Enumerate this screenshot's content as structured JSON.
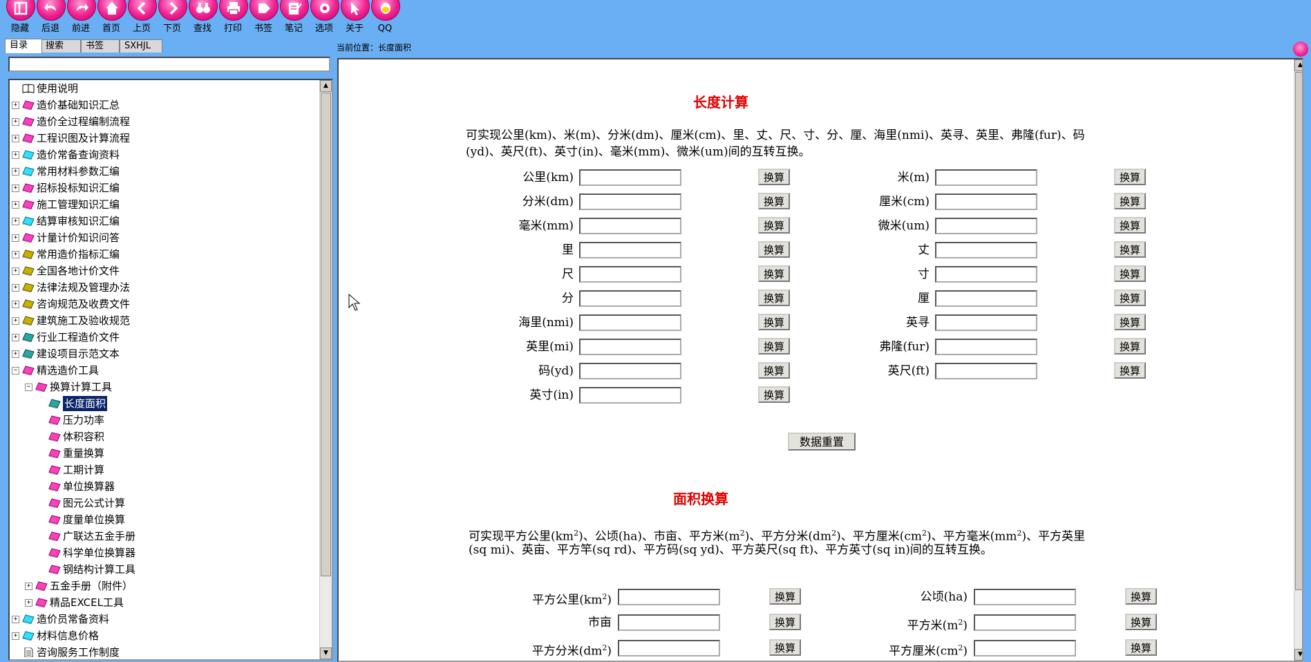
{
  "toolbar": {
    "buttons": [
      {
        "label": "隐藏",
        "icon": "hide-icon"
      },
      {
        "label": "后退",
        "icon": "back-icon"
      },
      {
        "label": "前进",
        "icon": "forward-icon"
      },
      {
        "label": "首页",
        "icon": "home-icon"
      },
      {
        "label": "上页",
        "icon": "prev-page-icon"
      },
      {
        "label": "下页",
        "icon": "next-page-icon"
      },
      {
        "label": "查找",
        "icon": "binoculars-icon"
      },
      {
        "label": "打印",
        "icon": "printer-icon"
      },
      {
        "label": "书签",
        "icon": "bookmark-icon"
      },
      {
        "label": "笔记",
        "icon": "note-icon"
      },
      {
        "label": "选项",
        "icon": "gear-icon"
      },
      {
        "label": "关于",
        "icon": "pointer-icon"
      },
      {
        "label": "QQ",
        "icon": "qq-icon"
      }
    ]
  },
  "tabs": [
    "目录",
    "搜索",
    "书签",
    "SXHJL"
  ],
  "search": {
    "value": ""
  },
  "tree": [
    {
      "label": "使用说明",
      "icon": "doc-book-icon",
      "level": 0,
      "toggle": ""
    },
    {
      "label": "造价基础知识汇总",
      "icon": "magenta-book-icon",
      "level": 0,
      "toggle": "+"
    },
    {
      "label": "造价全过程编制流程",
      "icon": "magenta-book-icon",
      "level": 0,
      "toggle": "+"
    },
    {
      "label": "工程识图及计算流程",
      "icon": "magenta-book-icon",
      "level": 0,
      "toggle": "+"
    },
    {
      "label": "造价常备查询资料",
      "icon": "cyan-book-icon",
      "level": 0,
      "toggle": "+"
    },
    {
      "label": "常用材料参数汇编",
      "icon": "cyan-book-icon",
      "level": 0,
      "toggle": "+"
    },
    {
      "label": "招标投标知识汇编",
      "icon": "magenta-book-icon",
      "level": 0,
      "toggle": "+"
    },
    {
      "label": "施工管理知识汇编",
      "icon": "magenta-book-icon",
      "level": 0,
      "toggle": "+"
    },
    {
      "label": "结算审核知识汇编",
      "icon": "cyan-book-icon",
      "level": 0,
      "toggle": "+"
    },
    {
      "label": "计量计价知识问答",
      "icon": "magenta-book-icon",
      "level": 0,
      "toggle": "+"
    },
    {
      "label": "常用造价指标汇编",
      "icon": "olive-book-icon",
      "level": 0,
      "toggle": "+"
    },
    {
      "label": "全国各地计价文件",
      "icon": "olive-book-icon",
      "level": 0,
      "toggle": "+"
    },
    {
      "label": "法律法规及管理办法",
      "icon": "olive-book-icon",
      "level": 0,
      "toggle": "+"
    },
    {
      "label": "咨询规范及收费文件",
      "icon": "olive-book-icon",
      "level": 0,
      "toggle": "+"
    },
    {
      "label": "建筑施工及验收规范",
      "icon": "olive-book-icon",
      "level": 0,
      "toggle": "+"
    },
    {
      "label": "行业工程造价文件",
      "icon": "teal-book-icon",
      "level": 0,
      "toggle": "+"
    },
    {
      "label": "建设项目示范文本",
      "icon": "teal-book-icon",
      "level": 0,
      "toggle": "+"
    },
    {
      "label": "精选造价工具",
      "icon": "magenta-book-icon",
      "level": 0,
      "toggle": "−"
    },
    {
      "label": "换算计算工具",
      "icon": "magenta-book-icon",
      "level": 1,
      "toggle": "−"
    },
    {
      "label": "长度面积",
      "icon": "teal-book-icon",
      "level": 2,
      "toggle": "",
      "selected": true
    },
    {
      "label": "压力功率",
      "icon": "magenta-book-icon",
      "level": 2,
      "toggle": ""
    },
    {
      "label": "体积容积",
      "icon": "magenta-book-icon",
      "level": 2,
      "toggle": ""
    },
    {
      "label": "重量换算",
      "icon": "magenta-book-icon",
      "level": 2,
      "toggle": ""
    },
    {
      "label": "工期计算",
      "icon": "magenta-book-icon",
      "level": 2,
      "toggle": ""
    },
    {
      "label": "单位换算器",
      "icon": "magenta-book-icon",
      "level": 2,
      "toggle": ""
    },
    {
      "label": "图元公式计算",
      "icon": "magenta-book-icon",
      "level": 2,
      "toggle": ""
    },
    {
      "label": "度量单位换算",
      "icon": "magenta-book-icon",
      "level": 2,
      "toggle": ""
    },
    {
      "label": "广联达五金手册",
      "icon": "magenta-book-icon",
      "level": 2,
      "toggle": ""
    },
    {
      "label": "科学单位换算器",
      "icon": "magenta-book-icon",
      "level": 2,
      "toggle": ""
    },
    {
      "label": "钢结构计算工具",
      "icon": "magenta-book-icon",
      "level": 2,
      "toggle": ""
    },
    {
      "label": "五金手册（附件）",
      "icon": "magenta-book-icon",
      "level": 1,
      "toggle": "+"
    },
    {
      "label": "精品EXCEL工具",
      "icon": "magenta-book-icon",
      "level": 1,
      "toggle": "+"
    },
    {
      "label": "造价员常备资料",
      "icon": "cyan-book-icon",
      "level": 0,
      "toggle": "+"
    },
    {
      "label": "材料信息价格",
      "icon": "cyan-book-icon",
      "level": 0,
      "toggle": "+"
    },
    {
      "label": "咨询服务工作制度",
      "icon": "doc-page-icon",
      "level": 0,
      "toggle": ""
    }
  ],
  "location": "当前位置：长度面积",
  "length": {
    "title": "长度计算",
    "desc_line1": "可实现公里(km)、米(m)、分米(dm)、厘米(cm)、里、丈、尺、寸、分、厘、海里(nmi)、英寻、英里、弗隆(fur)、码",
    "desc_line2": "(yd)、英尺(ft)、英寸(in)、毫米(mm)、微米(um)间的互转互换。",
    "button_label": "换算",
    "left_labels": [
      "公里(km)",
      "分米(dm)",
      "毫米(mm)",
      "里",
      "尺",
      "分",
      "海里(nmi)",
      "英里(mi)",
      "码(yd)",
      "英寸(in)"
    ],
    "right_labels": [
      "米(m)",
      "厘米(cm)",
      "微米(um)",
      "丈",
      "寸",
      "厘",
      "英寻",
      "弗隆(fur)",
      "英尺(ft)"
    ],
    "reset_label": "数据重置"
  },
  "area": {
    "title": "面积换算",
    "desc_line1_parts": [
      "可实现平方公里(km",
      "2",
      ")、公顷(ha)、市亩、平方米(m",
      "2",
      ")、平方分米(dm",
      "2",
      ")、平方厘米(cm",
      "2",
      ")、平方毫米(mm",
      "2",
      ")、平方英里"
    ],
    "desc_line2": "(sq mi)、英亩、平方竿(sq rd)、平方码(sq yd)、平方英尺(sq ft)、平方英寸(sq in)间的互转互换。",
    "button_label": "换算",
    "rows": [
      {
        "left": [
          "平方公里(km",
          "2",
          ")"
        ],
        "right": [
          "公顷(ha)",
          "",
          ""
        ]
      },
      {
        "left": [
          "市亩",
          "",
          ""
        ],
        "right": [
          "平方米(m",
          "2",
          ")"
        ]
      },
      {
        "left": [
          "平方分米(dm",
          "2",
          ")"
        ],
        "right": [
          "平方厘米(cm",
          "2",
          ")"
        ]
      }
    ]
  }
}
